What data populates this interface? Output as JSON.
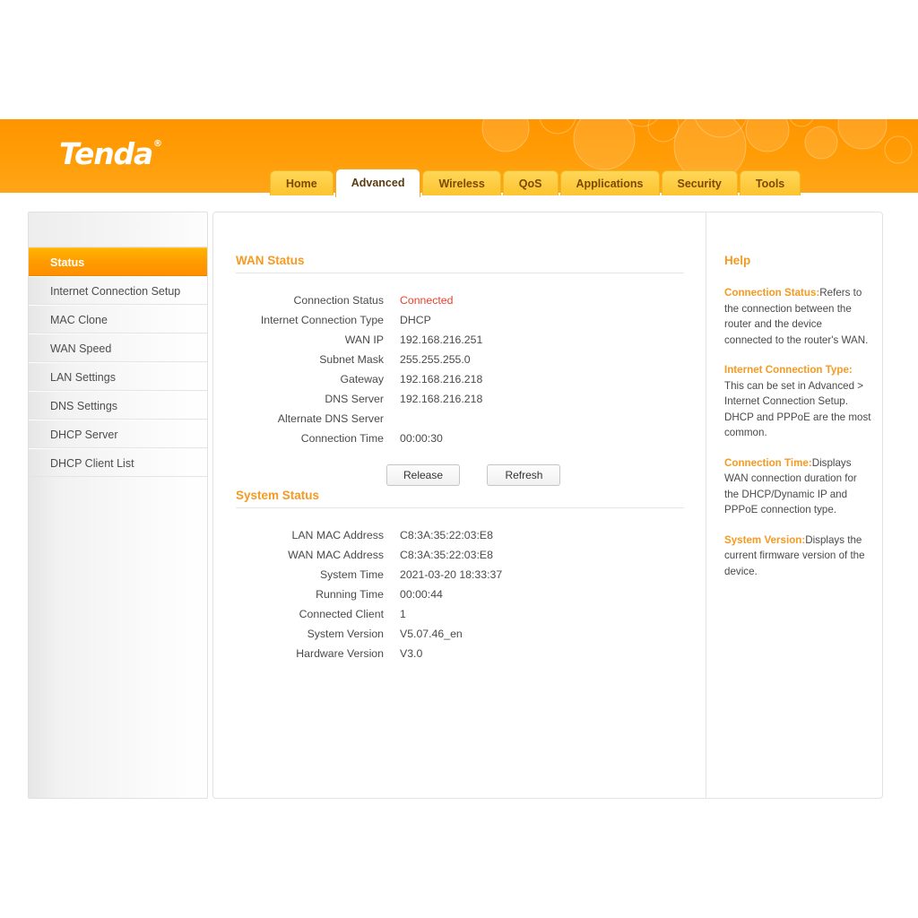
{
  "brand": {
    "logo_text": "Tenda",
    "trademark": "®"
  },
  "tabs": [
    {
      "label": "Home",
      "active": false
    },
    {
      "label": "Advanced",
      "active": true
    },
    {
      "label": "Wireless",
      "active": false
    },
    {
      "label": "QoS",
      "active": false
    },
    {
      "label": "Applications",
      "active": false
    },
    {
      "label": "Security",
      "active": false
    },
    {
      "label": "Tools",
      "active": false
    }
  ],
  "sidebar": {
    "items": [
      {
        "label": "Status",
        "active": true
      },
      {
        "label": "Internet Connection Setup",
        "active": false
      },
      {
        "label": "MAC Clone",
        "active": false
      },
      {
        "label": "WAN Speed",
        "active": false
      },
      {
        "label": "LAN Settings",
        "active": false
      },
      {
        "label": "DNS Settings",
        "active": false
      },
      {
        "label": "DHCP Server",
        "active": false
      },
      {
        "label": "DHCP Client List",
        "active": false
      }
    ]
  },
  "wan_status": {
    "title": "WAN Status",
    "rows": [
      {
        "label": "Connection Status",
        "value": "Connected",
        "highlight": "connected"
      },
      {
        "label": "Internet Connection Type",
        "value": "DHCP"
      },
      {
        "label": "WAN IP",
        "value": "192.168.216.251"
      },
      {
        "label": "Subnet Mask",
        "value": "255.255.255.0"
      },
      {
        "label": "Gateway",
        "value": "192.168.216.218"
      },
      {
        "label": "DNS Server",
        "value": "192.168.216.218"
      },
      {
        "label": "Alternate DNS Server",
        "value": ""
      },
      {
        "label": "Connection Time",
        "value": "00:00:30"
      }
    ],
    "buttons": {
      "release": "Release",
      "refresh": "Refresh"
    }
  },
  "system_status": {
    "title": "System Status",
    "rows": [
      {
        "label": "LAN MAC Address",
        "value": "C8:3A:35:22:03:E8"
      },
      {
        "label": "WAN MAC Address",
        "value": "C8:3A:35:22:03:E8"
      },
      {
        "label": "System Time",
        "value": "2021-03-20 18:33:37"
      },
      {
        "label": "Running Time",
        "value": "00:00:44"
      },
      {
        "label": "Connected Client",
        "value": "1"
      },
      {
        "label": "System Version",
        "value": "V5.07.46_en"
      },
      {
        "label": "Hardware Version",
        "value": "V3.0"
      }
    ]
  },
  "help": {
    "title": "Help",
    "blocks": [
      {
        "term": "Connection Status:",
        "text": "Refers to the connection between the router and the device connected to the router's WAN."
      },
      {
        "term": "Internet Connection Type:",
        "text": " This can be set in Advanced > Internet Connection Setup. DHCP and PPPoE are the most common."
      },
      {
        "term": "Connection Time:",
        "text": "Displays WAN connection duration for the DHCP/Dynamic IP and PPPoE connection type."
      },
      {
        "term": "System Version:",
        "text": "Displays the current firmware version of the device."
      }
    ]
  },
  "colors": {
    "brand_orange": "#ff9900",
    "heading_orange": "#f59a22",
    "status_red": "#e8412c",
    "tab_yellow": "#fdc93a"
  }
}
